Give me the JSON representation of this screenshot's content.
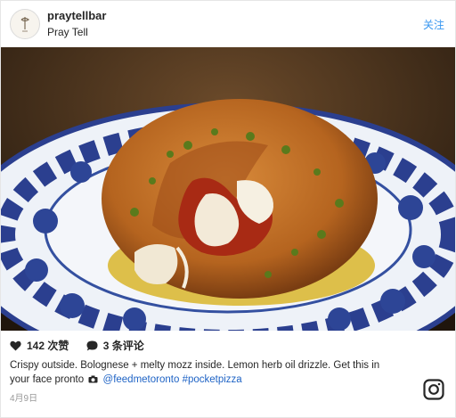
{
  "post": {
    "username": "praytellbar",
    "location": "Pray Tell",
    "follow_label": "关注",
    "likes": "142 次赞",
    "comments": "3 条评论",
    "caption_text": "Crispy outside. Bolognese + melty mozz inside. Lemon herb oil drizzle. Get this in your face pronto",
    "caption_mention": "@feedmetoronto",
    "caption_hashtag": "#pocketpizza",
    "date": "4月9日"
  },
  "icons": {
    "like": "heart-icon",
    "comment": "comment-bubble-icon",
    "camera": "camera-icon",
    "instagram": "instagram-logo-icon"
  },
  "colors": {
    "link": "#3897f0",
    "hashtag": "#1e63c5",
    "text": "#262626",
    "muted": "#999999"
  }
}
